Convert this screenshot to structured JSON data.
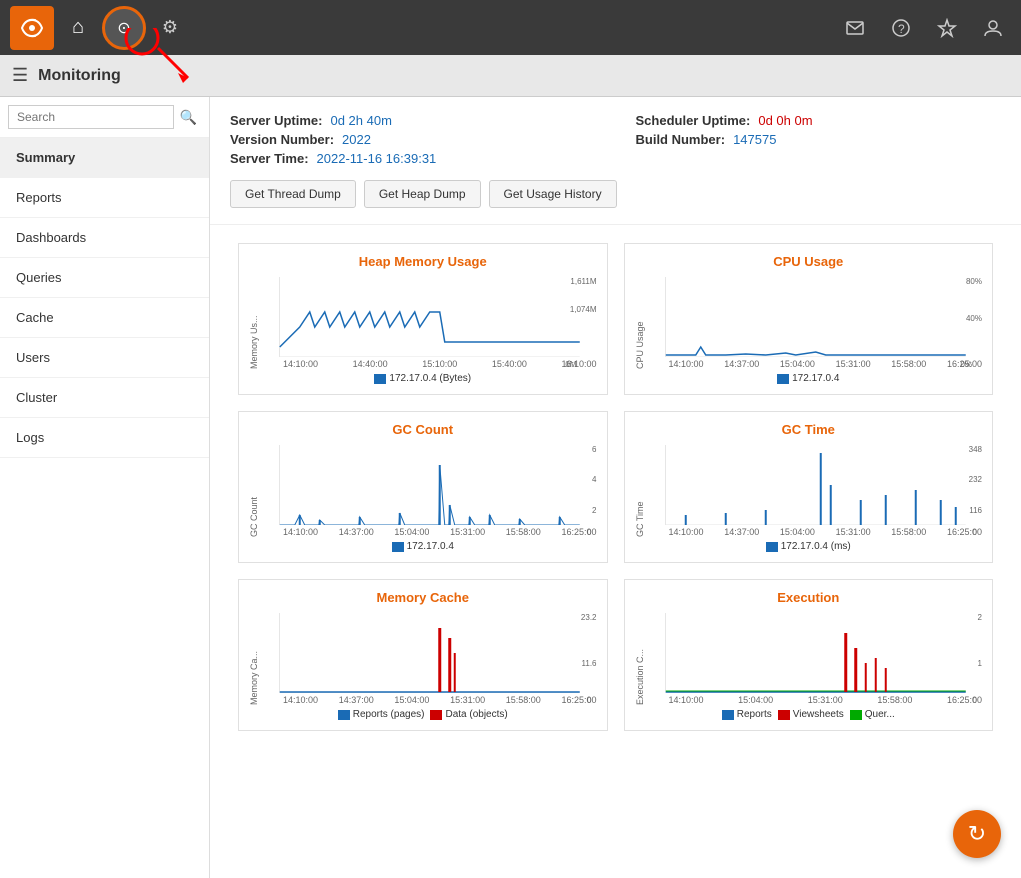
{
  "topNav": {
    "title": "Monitoring",
    "icons": {
      "home": "🏠",
      "monitoring": "⊙",
      "settings": "⚙"
    },
    "rightIcons": [
      "✉",
      "?",
      "☆",
      "👤"
    ]
  },
  "sidebar": {
    "searchPlaceholder": "Search",
    "items": [
      {
        "label": "Summary",
        "active": true
      },
      {
        "label": "Reports",
        "active": false
      },
      {
        "label": "Dashboards",
        "active": false
      },
      {
        "label": "Queries",
        "active": false
      },
      {
        "label": "Cache",
        "active": false
      },
      {
        "label": "Users",
        "active": false
      },
      {
        "label": "Cluster",
        "active": false
      },
      {
        "label": "Logs",
        "active": false
      }
    ]
  },
  "serverInfo": {
    "uptime": {
      "label": "Server Uptime:",
      "value": "0d 2h 40m"
    },
    "schedulerUptime": {
      "label": "Scheduler Uptime:",
      "value": "0d 0h 0m"
    },
    "versionNumber": {
      "label": "Version Number:",
      "value": "2022"
    },
    "buildNumber": {
      "label": "Build Number:",
      "value": "147575"
    },
    "serverTime": {
      "label": "Server Time:",
      "value": "2022-11-16 16:39:31"
    }
  },
  "buttons": {
    "threadDump": "Get Thread Dump",
    "heapDump": "Get Heap Dump",
    "usageHistory": "Get Usage History"
  },
  "charts": {
    "heapMemory": {
      "title": "Heap Memory Usage",
      "yLabel": "Memory Us...",
      "yTicks": [
        "1,611M",
        "1,074M",
        "0M"
      ],
      "xLabels": [
        "14:10:00",
        "14:40:00",
        "15:10:00",
        "15:40:00",
        "16:10:00"
      ],
      "legend": [
        {
          "color": "blue",
          "label": "172.17.0.4 (Bytes)"
        }
      ]
    },
    "cpu": {
      "title": "CPU Usage",
      "yLabel": "CPU Usage",
      "yTicks": [
        "80%",
        "40%",
        "0%"
      ],
      "xLabels": [
        "14:10:00",
        "14:37:00",
        "15:04:00",
        "15:31:00",
        "15:58:00",
        "16:25:00"
      ],
      "legend": [
        {
          "color": "blue",
          "label": "172.17.0.4"
        }
      ]
    },
    "gcCount": {
      "title": "GC Count",
      "yLabel": "GC Count",
      "yTicks": [
        "6",
        "4",
        "2",
        "0"
      ],
      "xLabels": [
        "14:10:00",
        "14:37:00",
        "15:04:00",
        "15:31:00",
        "15:58:00",
        "16:25:00"
      ],
      "legend": [
        {
          "color": "blue",
          "label": "172.17.0.4"
        }
      ]
    },
    "gcTime": {
      "title": "GC Time",
      "yLabel": "GC Time",
      "yTicks": [
        "348",
        "232",
        "116",
        "0"
      ],
      "xLabels": [
        "14:10:00",
        "14:37:00",
        "15:04:00",
        "15:31:00",
        "15:58:00",
        "16:25:00"
      ],
      "legend": [
        {
          "color": "blue",
          "label": "172.17.0.4 (ms)"
        }
      ]
    },
    "memoryCache": {
      "title": "Memory Cache",
      "yLabel": "Memory Ca...",
      "yTicks": [
        "23.2",
        "11.6",
        "0"
      ],
      "xLabels": [
        "14:10:00",
        "14:37:00",
        "15:04:00",
        "15:31:00",
        "15:58:00",
        "16:25:00"
      ],
      "legend": [
        {
          "color": "blue",
          "label": "Reports (pages)"
        },
        {
          "color": "red",
          "label": "Data (objects)"
        }
      ]
    },
    "execution": {
      "title": "Execution",
      "yLabel": "Execution C...",
      "yTicks": [
        "2",
        "1",
        "0"
      ],
      "xLabels": [
        "14:10:00",
        "15:04:00",
        "15:31:00",
        "15:58:00",
        "16:25:00"
      ],
      "legend": [
        {
          "color": "blue",
          "label": "Reports"
        },
        {
          "color": "red",
          "label": "Viewsheets"
        },
        {
          "color": "green",
          "label": "Quer..."
        }
      ]
    }
  },
  "refreshButton": "↻"
}
